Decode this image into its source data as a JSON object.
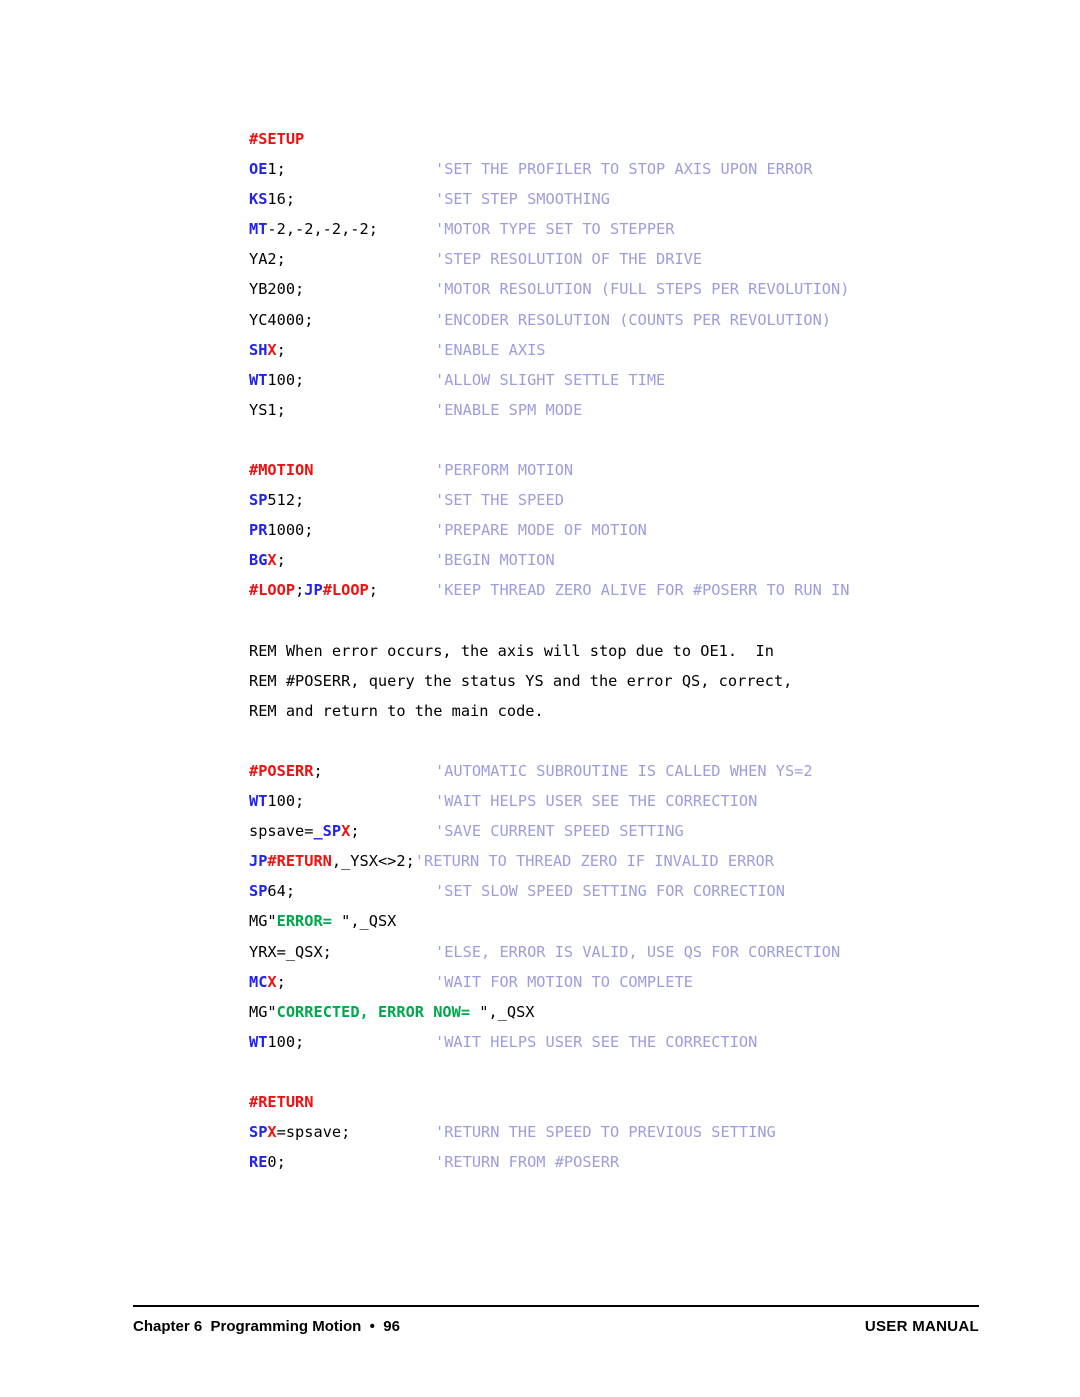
{
  "document": {
    "page_number": "96",
    "footer_left": "Chapter 6  Programming Motion  •  96",
    "footer_right": "USER MANUAL"
  },
  "listing": {
    "lines": [
      {
        "id": "setup-label",
        "segments": [
          {
            "text": "#SETUP",
            "color": "red"
          }
        ]
      },
      {
        "id": "oe1",
        "code": [
          {
            "text": "OE",
            "color": "blue"
          },
          {
            "text": "1;",
            "color": "black"
          }
        ],
        "comment": "'SET THE PROFILER TO STOP AXIS UPON ERROR"
      },
      {
        "id": "ks16",
        "code": [
          {
            "text": "KS",
            "color": "blue"
          },
          {
            "text": "16;",
            "color": "black"
          }
        ],
        "comment": "'SET STEP SMOOTHING"
      },
      {
        "id": "mt",
        "code": [
          {
            "text": "MT",
            "color": "blue"
          },
          {
            "text": "-2,-2,-2,-2;",
            "color": "black"
          }
        ],
        "comment": "'MOTOR TYPE SET TO STEPPER"
      },
      {
        "id": "ya2",
        "code": [
          {
            "text": "YA2;",
            "color": "black"
          }
        ],
        "comment": "'STEP RESOLUTION OF THE DRIVE"
      },
      {
        "id": "yb200",
        "code": [
          {
            "text": "YB200;",
            "color": "black"
          }
        ],
        "comment": "'MOTOR RESOLUTION (FULL STEPS PER REVOLUTION)"
      },
      {
        "id": "yc4000",
        "code": [
          {
            "text": "YC4000;",
            "color": "black"
          }
        ],
        "comment": "'ENCODER RESOLUTION (COUNTS PER REVOLUTION)"
      },
      {
        "id": "shx",
        "code": [
          {
            "text": "SH",
            "color": "blue"
          },
          {
            "text": "X",
            "color": "red"
          },
          {
            "text": ";",
            "color": "black"
          }
        ],
        "comment": "'ENABLE AXIS"
      },
      {
        "id": "wt100-a",
        "code": [
          {
            "text": "WT",
            "color": "blue"
          },
          {
            "text": "100;",
            "color": "black"
          }
        ],
        "comment": "'ALLOW SLIGHT SETTLE TIME"
      },
      {
        "id": "ys1",
        "code": [
          {
            "text": "YS1;",
            "color": "black"
          }
        ],
        "comment": "'ENABLE SPM MODE"
      },
      {
        "id": "blank-1",
        "blank": true
      },
      {
        "id": "motion-label",
        "code": [
          {
            "text": "#MOTION",
            "color": "red"
          }
        ],
        "comment": "'PERFORM MOTION"
      },
      {
        "id": "sp512",
        "code": [
          {
            "text": "SP",
            "color": "blue"
          },
          {
            "text": "512;",
            "color": "black"
          }
        ],
        "comment": "'SET THE SPEED"
      },
      {
        "id": "pr1000",
        "code": [
          {
            "text": "PR",
            "color": "blue"
          },
          {
            "text": "1000;",
            "color": "black"
          }
        ],
        "comment": "'PREPARE MODE OF MOTION"
      },
      {
        "id": "bgx",
        "code": [
          {
            "text": "BG",
            "color": "blue"
          },
          {
            "text": "X",
            "color": "red"
          },
          {
            "text": ";",
            "color": "black"
          }
        ],
        "comment": "'BEGIN MOTION"
      },
      {
        "id": "loop",
        "code": [
          {
            "text": "#LOOP",
            "color": "red"
          },
          {
            "text": ";",
            "color": "black"
          },
          {
            "text": "JP",
            "color": "blue"
          },
          {
            "text": "#LOOP",
            "color": "red"
          },
          {
            "text": ";",
            "color": "black"
          }
        ],
        "comment": "'KEEP THREAD ZERO ALIVE FOR #POSERR TO RUN IN"
      },
      {
        "id": "blank-2",
        "blank": true
      },
      {
        "id": "rem-1",
        "prose": "REM When error occurs, the axis will stop due to OE1.  In"
      },
      {
        "id": "rem-2",
        "prose": "REM #POSERR, query the status YS and the error QS, correct,"
      },
      {
        "id": "rem-3",
        "prose": "REM and return to the main code."
      },
      {
        "id": "blank-3",
        "blank": true
      },
      {
        "id": "poserr-label",
        "code": [
          {
            "text": "#POSERR",
            "color": "red"
          },
          {
            "text": ";",
            "color": "black"
          }
        ],
        "comment": "'AUTOMATIC SUBROUTINE IS CALLED WHEN YS=2"
      },
      {
        "id": "wt100-b",
        "code": [
          {
            "text": "WT",
            "color": "blue"
          },
          {
            "text": "100;",
            "color": "black"
          }
        ],
        "comment": "'WAIT HELPS USER SEE THE CORRECTION"
      },
      {
        "id": "spsave-assign",
        "code": [
          {
            "text": "spsave=",
            "color": "black"
          },
          {
            "text": "_SP",
            "color": "blue"
          },
          {
            "text": "X",
            "color": "red"
          },
          {
            "text": ";",
            "color": "black"
          }
        ],
        "comment": "'SAVE CURRENT SPEED SETTING"
      },
      {
        "id": "jp-return",
        "code": [
          {
            "text": "JP",
            "color": "blue"
          },
          {
            "text": "#RETURN",
            "color": "red"
          },
          {
            "text": ",_YSX<>2;",
            "color": "black"
          }
        ],
        "comment": "'RETURN TO THREAD ZERO IF INVALID ERROR",
        "tight": true
      },
      {
        "id": "sp64",
        "code": [
          {
            "text": "SP",
            "color": "blue"
          },
          {
            "text": "64;",
            "color": "black"
          }
        ],
        "comment": "'SET SLOW SPEED SETTING FOR CORRECTION"
      },
      {
        "id": "mg-error",
        "code": [
          {
            "text": "MG\"",
            "color": "black"
          },
          {
            "text": "ERROR= ",
            "color": "green"
          },
          {
            "text": "\",_QSX",
            "color": "black"
          }
        ],
        "comment": ""
      },
      {
        "id": "yrx-assign",
        "code": [
          {
            "text": "YRX=_QSX;",
            "color": "black"
          }
        ],
        "comment": "'ELSE, ERROR IS VALID, USE QS FOR CORRECTION"
      },
      {
        "id": "mcx",
        "code": [
          {
            "text": "MC",
            "color": "blue"
          },
          {
            "text": "X",
            "color": "red"
          },
          {
            "text": ";",
            "color": "black"
          }
        ],
        "comment": "'WAIT FOR MOTION TO COMPLETE"
      },
      {
        "id": "mg-corrected",
        "code": [
          {
            "text": "MG\"",
            "color": "black"
          },
          {
            "text": "CORRECTED, ERROR NOW= ",
            "color": "green"
          },
          {
            "text": "\",_QSX",
            "color": "black"
          }
        ],
        "comment": ""
      },
      {
        "id": "wt100-c",
        "code": [
          {
            "text": "WT",
            "color": "blue"
          },
          {
            "text": "100;",
            "color": "black"
          }
        ],
        "comment": "'WAIT HELPS USER SEE THE CORRECTION"
      },
      {
        "id": "blank-4",
        "blank": true
      },
      {
        "id": "return-label",
        "code": [
          {
            "text": "#RETURN",
            "color": "red"
          }
        ],
        "comment": ""
      },
      {
        "id": "spx-assign",
        "code": [
          {
            "text": "SP",
            "color": "blue"
          },
          {
            "text": "X",
            "color": "red"
          },
          {
            "text": "=spsave;",
            "color": "black"
          }
        ],
        "comment": "'RETURN THE SPEED TO PREVIOUS SETTING"
      },
      {
        "id": "re0",
        "code": [
          {
            "text": "RE",
            "color": "blue"
          },
          {
            "text": "0;",
            "color": "black"
          }
        ],
        "comment": "'RETURN FROM #POSERR"
      }
    ]
  },
  "colors": {
    "keyword": "#2222EE",
    "label": "#EE1111",
    "comment": "#9D9DDD",
    "string": "#00A84B",
    "text": "#000000"
  }
}
